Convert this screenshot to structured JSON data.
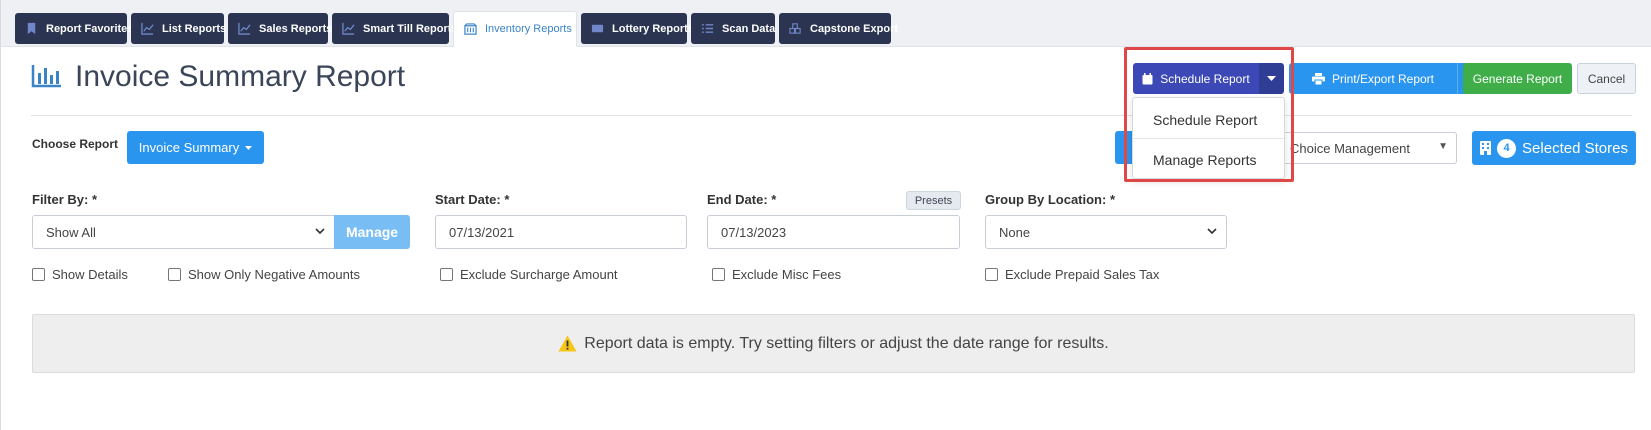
{
  "tabs": [
    {
      "label": "Report Favorites",
      "icon": "bookmark-icon"
    },
    {
      "label": "List Reports",
      "icon": "line-chart-icon"
    },
    {
      "label": "Sales Reports",
      "icon": "line-chart-icon"
    },
    {
      "label": "Smart Till Reports",
      "icon": "line-chart-icon"
    },
    {
      "label": "Inventory Reports",
      "icon": "inventory-icon",
      "active": true
    },
    {
      "label": "Lottery Reports",
      "icon": "ticket-icon"
    },
    {
      "label": "Scan Data",
      "icon": "list-icon"
    },
    {
      "label": "Capstone Export",
      "icon": "cubes-icon"
    }
  ],
  "header": {
    "title": "Invoice Summary Report",
    "title_icon": "bar-chart-icon",
    "schedule_label": "Schedule Report",
    "print_label": "Print/Export Report",
    "generate_label": "Generate Report",
    "cancel_label": "Cancel"
  },
  "schedule_menu": {
    "items": [
      "Schedule Report",
      "Manage Reports"
    ]
  },
  "choose": {
    "label": "Choose Report",
    "value": "Invoice Summary"
  },
  "management": {
    "value": "Choice Management"
  },
  "stores": {
    "count": "4",
    "label": "Selected Stores"
  },
  "filters": {
    "filter_by": {
      "label": "Filter By: *",
      "value": "Show All",
      "manage_label": "Manage"
    },
    "start_date": {
      "label": "Start Date: *",
      "value": "07/13/2021"
    },
    "end_date": {
      "label": "End Date: *",
      "value": "07/13/2023",
      "presets_label": "Presets"
    },
    "group_by": {
      "label": "Group By Location: *",
      "value": "None"
    }
  },
  "checkboxes": [
    {
      "label": "Show Details",
      "checked": false
    },
    {
      "label": "Show Only Negative Amounts",
      "checked": false
    },
    {
      "label": "Exclude Surcharge Amount",
      "checked": false
    },
    {
      "label": "Exclude Misc Fees",
      "checked": false
    },
    {
      "label": "Exclude Prepaid Sales Tax",
      "checked": false
    }
  ],
  "empty_message": "Report data is empty. Try setting filters or adjust the date range for results.",
  "colors": {
    "tab_bg": "#2b3551",
    "schedule": "#3b48b5",
    "primary": "#2a95ee",
    "generate": "#3fae49",
    "highlight": "#e04848",
    "warning": "#f5c518"
  }
}
